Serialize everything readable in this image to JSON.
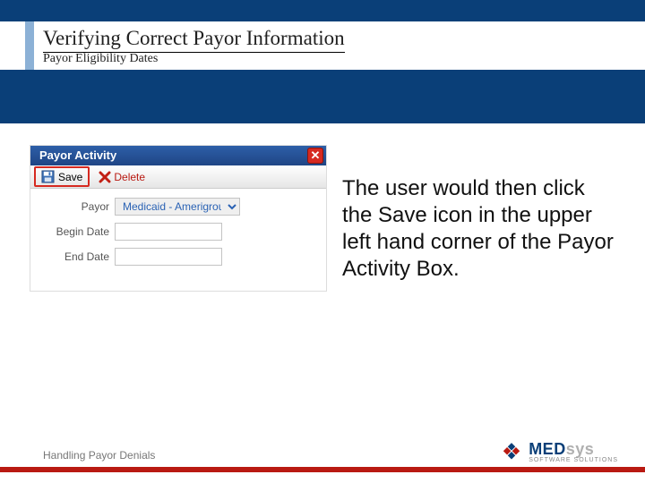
{
  "slide": {
    "title": "Verifying Correct Payor Information",
    "subtitle": "Payor Eligibility Dates",
    "instruction": "The user would then click the Save icon in the upper left hand corner of the Payor Activity Box.",
    "footer": "Handling Payor Denials"
  },
  "window": {
    "title": "Payor Activity",
    "toolbar": {
      "save_label": "Save",
      "delete_label": "Delete"
    },
    "fields": {
      "payor_label": "Payor",
      "payor_value": "Medicaid - Amerigroup",
      "begin_label": "Begin Date",
      "begin_value": "",
      "end_label": "End Date",
      "end_value": ""
    },
    "close_glyph": "✕"
  },
  "logo": {
    "part1": "MED",
    "part2": "sys",
    "tagline": "SOFTWARE SOLUTIONS"
  }
}
